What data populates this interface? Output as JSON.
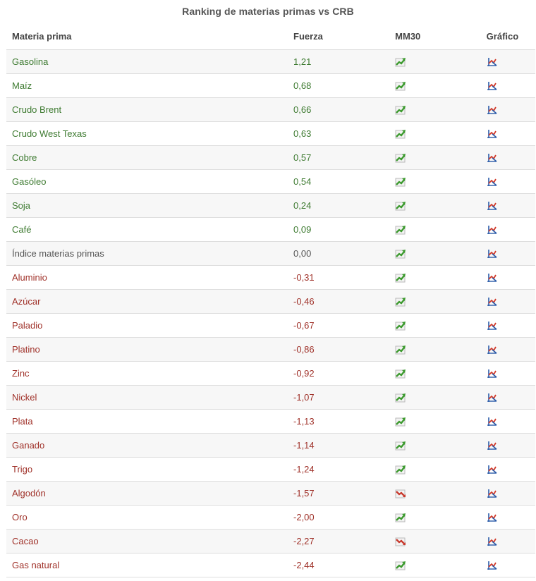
{
  "title": "Ranking de materias primas vs CRB",
  "headers": {
    "name": "Materia prima",
    "strength": "Fuerza",
    "ma": "MM30",
    "chart": "Gráfico"
  },
  "colors": {
    "positive": "#3d7a30",
    "neutral": "#555555",
    "negative": "#a0322a"
  },
  "icons": {
    "ma_up": "trend-up-icon",
    "ma_down": "trend-down-icon",
    "chart": "chart-link-icon"
  },
  "rows": [
    {
      "name": "Gasolina",
      "strength": "1,21",
      "ma": "up",
      "tone": "pos"
    },
    {
      "name": "Maíz",
      "strength": "0,68",
      "ma": "up",
      "tone": "pos"
    },
    {
      "name": "Crudo Brent",
      "strength": "0,66",
      "ma": "up",
      "tone": "pos"
    },
    {
      "name": "Crudo West Texas",
      "strength": "0,63",
      "ma": "up",
      "tone": "pos"
    },
    {
      "name": "Cobre",
      "strength": "0,57",
      "ma": "up",
      "tone": "pos"
    },
    {
      "name": "Gasóleo",
      "strength": "0,54",
      "ma": "up",
      "tone": "pos"
    },
    {
      "name": "Soja",
      "strength": "0,24",
      "ma": "up",
      "tone": "pos"
    },
    {
      "name": "Café",
      "strength": "0,09",
      "ma": "up",
      "tone": "pos"
    },
    {
      "name": "Índice materias primas",
      "strength": "0,00",
      "ma": "up",
      "tone": "neu"
    },
    {
      "name": "Aluminio",
      "strength": "-0,31",
      "ma": "up",
      "tone": "neg"
    },
    {
      "name": "Azúcar",
      "strength": "-0,46",
      "ma": "up",
      "tone": "neg"
    },
    {
      "name": "Paladio",
      "strength": "-0,67",
      "ma": "up",
      "tone": "neg"
    },
    {
      "name": "Platino",
      "strength": "-0,86",
      "ma": "up",
      "tone": "neg"
    },
    {
      "name": "Zinc",
      "strength": "-0,92",
      "ma": "up",
      "tone": "neg"
    },
    {
      "name": "Nickel",
      "strength": "-1,07",
      "ma": "up",
      "tone": "neg"
    },
    {
      "name": "Plata",
      "strength": "-1,13",
      "ma": "up",
      "tone": "neg"
    },
    {
      "name": "Ganado",
      "strength": "-1,14",
      "ma": "up",
      "tone": "neg"
    },
    {
      "name": "Trigo",
      "strength": "-1,24",
      "ma": "up",
      "tone": "neg"
    },
    {
      "name": "Algodón",
      "strength": "-1,57",
      "ma": "down",
      "tone": "neg"
    },
    {
      "name": "Oro",
      "strength": "-2,00",
      "ma": "up",
      "tone": "neg"
    },
    {
      "name": "Cacao",
      "strength": "-2,27",
      "ma": "down",
      "tone": "neg"
    },
    {
      "name": "Gas natural",
      "strength": "-2,44",
      "ma": "up",
      "tone": "neg"
    }
  ]
}
